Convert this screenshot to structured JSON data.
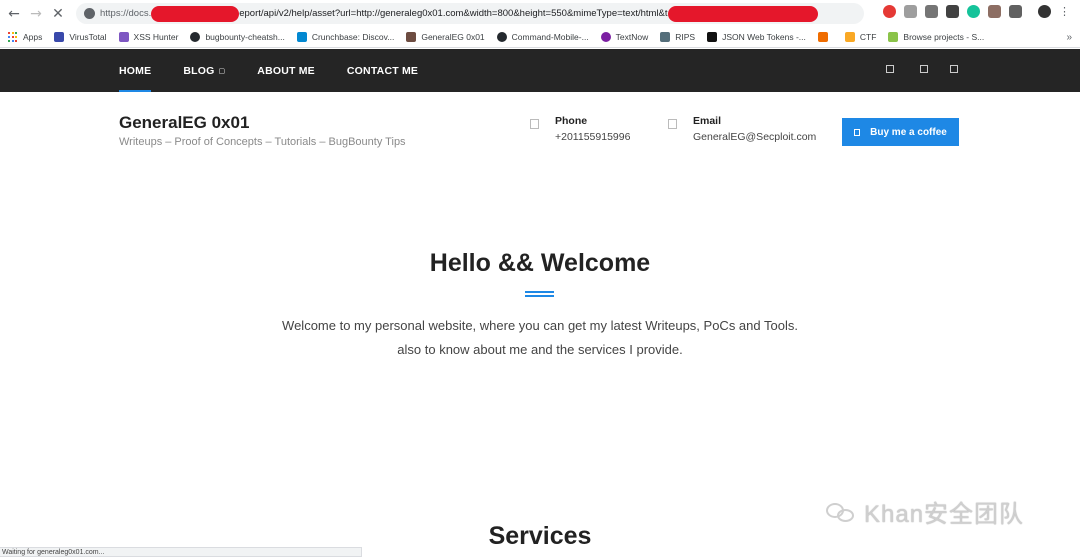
{
  "browser": {
    "url_scheme": "https://docs.",
    "url_middle": "eport/api/v2/help/asset?url=http://generaleg0x01.com&width=800&height=550&mimeType=text/html&t",
    "bookmarks": [
      {
        "label": "Apps",
        "icon": "apps-grid-icon"
      },
      {
        "label": "VirusTotal",
        "icon": "virustotal-icon",
        "color": "#3949ab"
      },
      {
        "label": "XSS Hunter",
        "icon": "xss-hunter-icon",
        "color": "#7e57c2"
      },
      {
        "label": "bugbounty-cheatsh...",
        "icon": "github-icon",
        "color": "#24292e"
      },
      {
        "label": "Crunchbase: Discov...",
        "icon": "crunchbase-icon",
        "color": "#0288d1"
      },
      {
        "label": "GeneralEG 0x01",
        "icon": "generaleg-icon",
        "color": "#6d4c41"
      },
      {
        "label": "Command-Mobile-...",
        "icon": "github-icon",
        "color": "#24292e"
      },
      {
        "label": "TextNow",
        "icon": "textnow-icon",
        "color": "#7b1fa2"
      },
      {
        "label": "RIPS",
        "icon": "rips-icon",
        "color": "#546e7a"
      },
      {
        "label": "JSON Web Tokens -...",
        "icon": "jwt-icon",
        "color": "#111111"
      },
      {
        "label": "",
        "icon": "cp-icon",
        "color": "#ef6c00"
      },
      {
        "label": "CTF",
        "icon": "folder-icon",
        "color": "#f9a825"
      },
      {
        "label": "Browse projects - S...",
        "icon": "projects-icon",
        "color": "#8bc34a"
      }
    ],
    "more": "»",
    "status": "Waiting for generaleg0x01.com..."
  },
  "nav": {
    "items": [
      {
        "label": "HOME",
        "active": true,
        "dropdown": false
      },
      {
        "label": "BLOG",
        "active": false,
        "dropdown": true
      },
      {
        "label": "ABOUT ME",
        "active": false,
        "dropdown": false
      },
      {
        "label": "CONTACT ME",
        "active": false,
        "dropdown": false
      }
    ],
    "dropdown_glyph": "▢"
  },
  "header": {
    "title": "GeneralEG 0x01",
    "tagline": "Writeups – Proof of Concepts – Tutorials – BugBounty Tips",
    "phone_label": "Phone",
    "phone_value": "+201155915996",
    "email_label": "Email",
    "email_value": "GeneralEG@Secploit.com",
    "coffee_label": "Buy me a coffee"
  },
  "hero": {
    "title": "Hello && Welcome",
    "line1": "Welcome to my personal website, where you can get my latest Writeups, PoCs and Tools.",
    "line2": "also to know about me and the services I provide."
  },
  "services": {
    "title": "Services"
  },
  "watermark": {
    "text": "Khan安全团队"
  },
  "colors": {
    "accent": "#1e88e5",
    "nav_bg": "#252525",
    "redaction": "#e5172b"
  }
}
